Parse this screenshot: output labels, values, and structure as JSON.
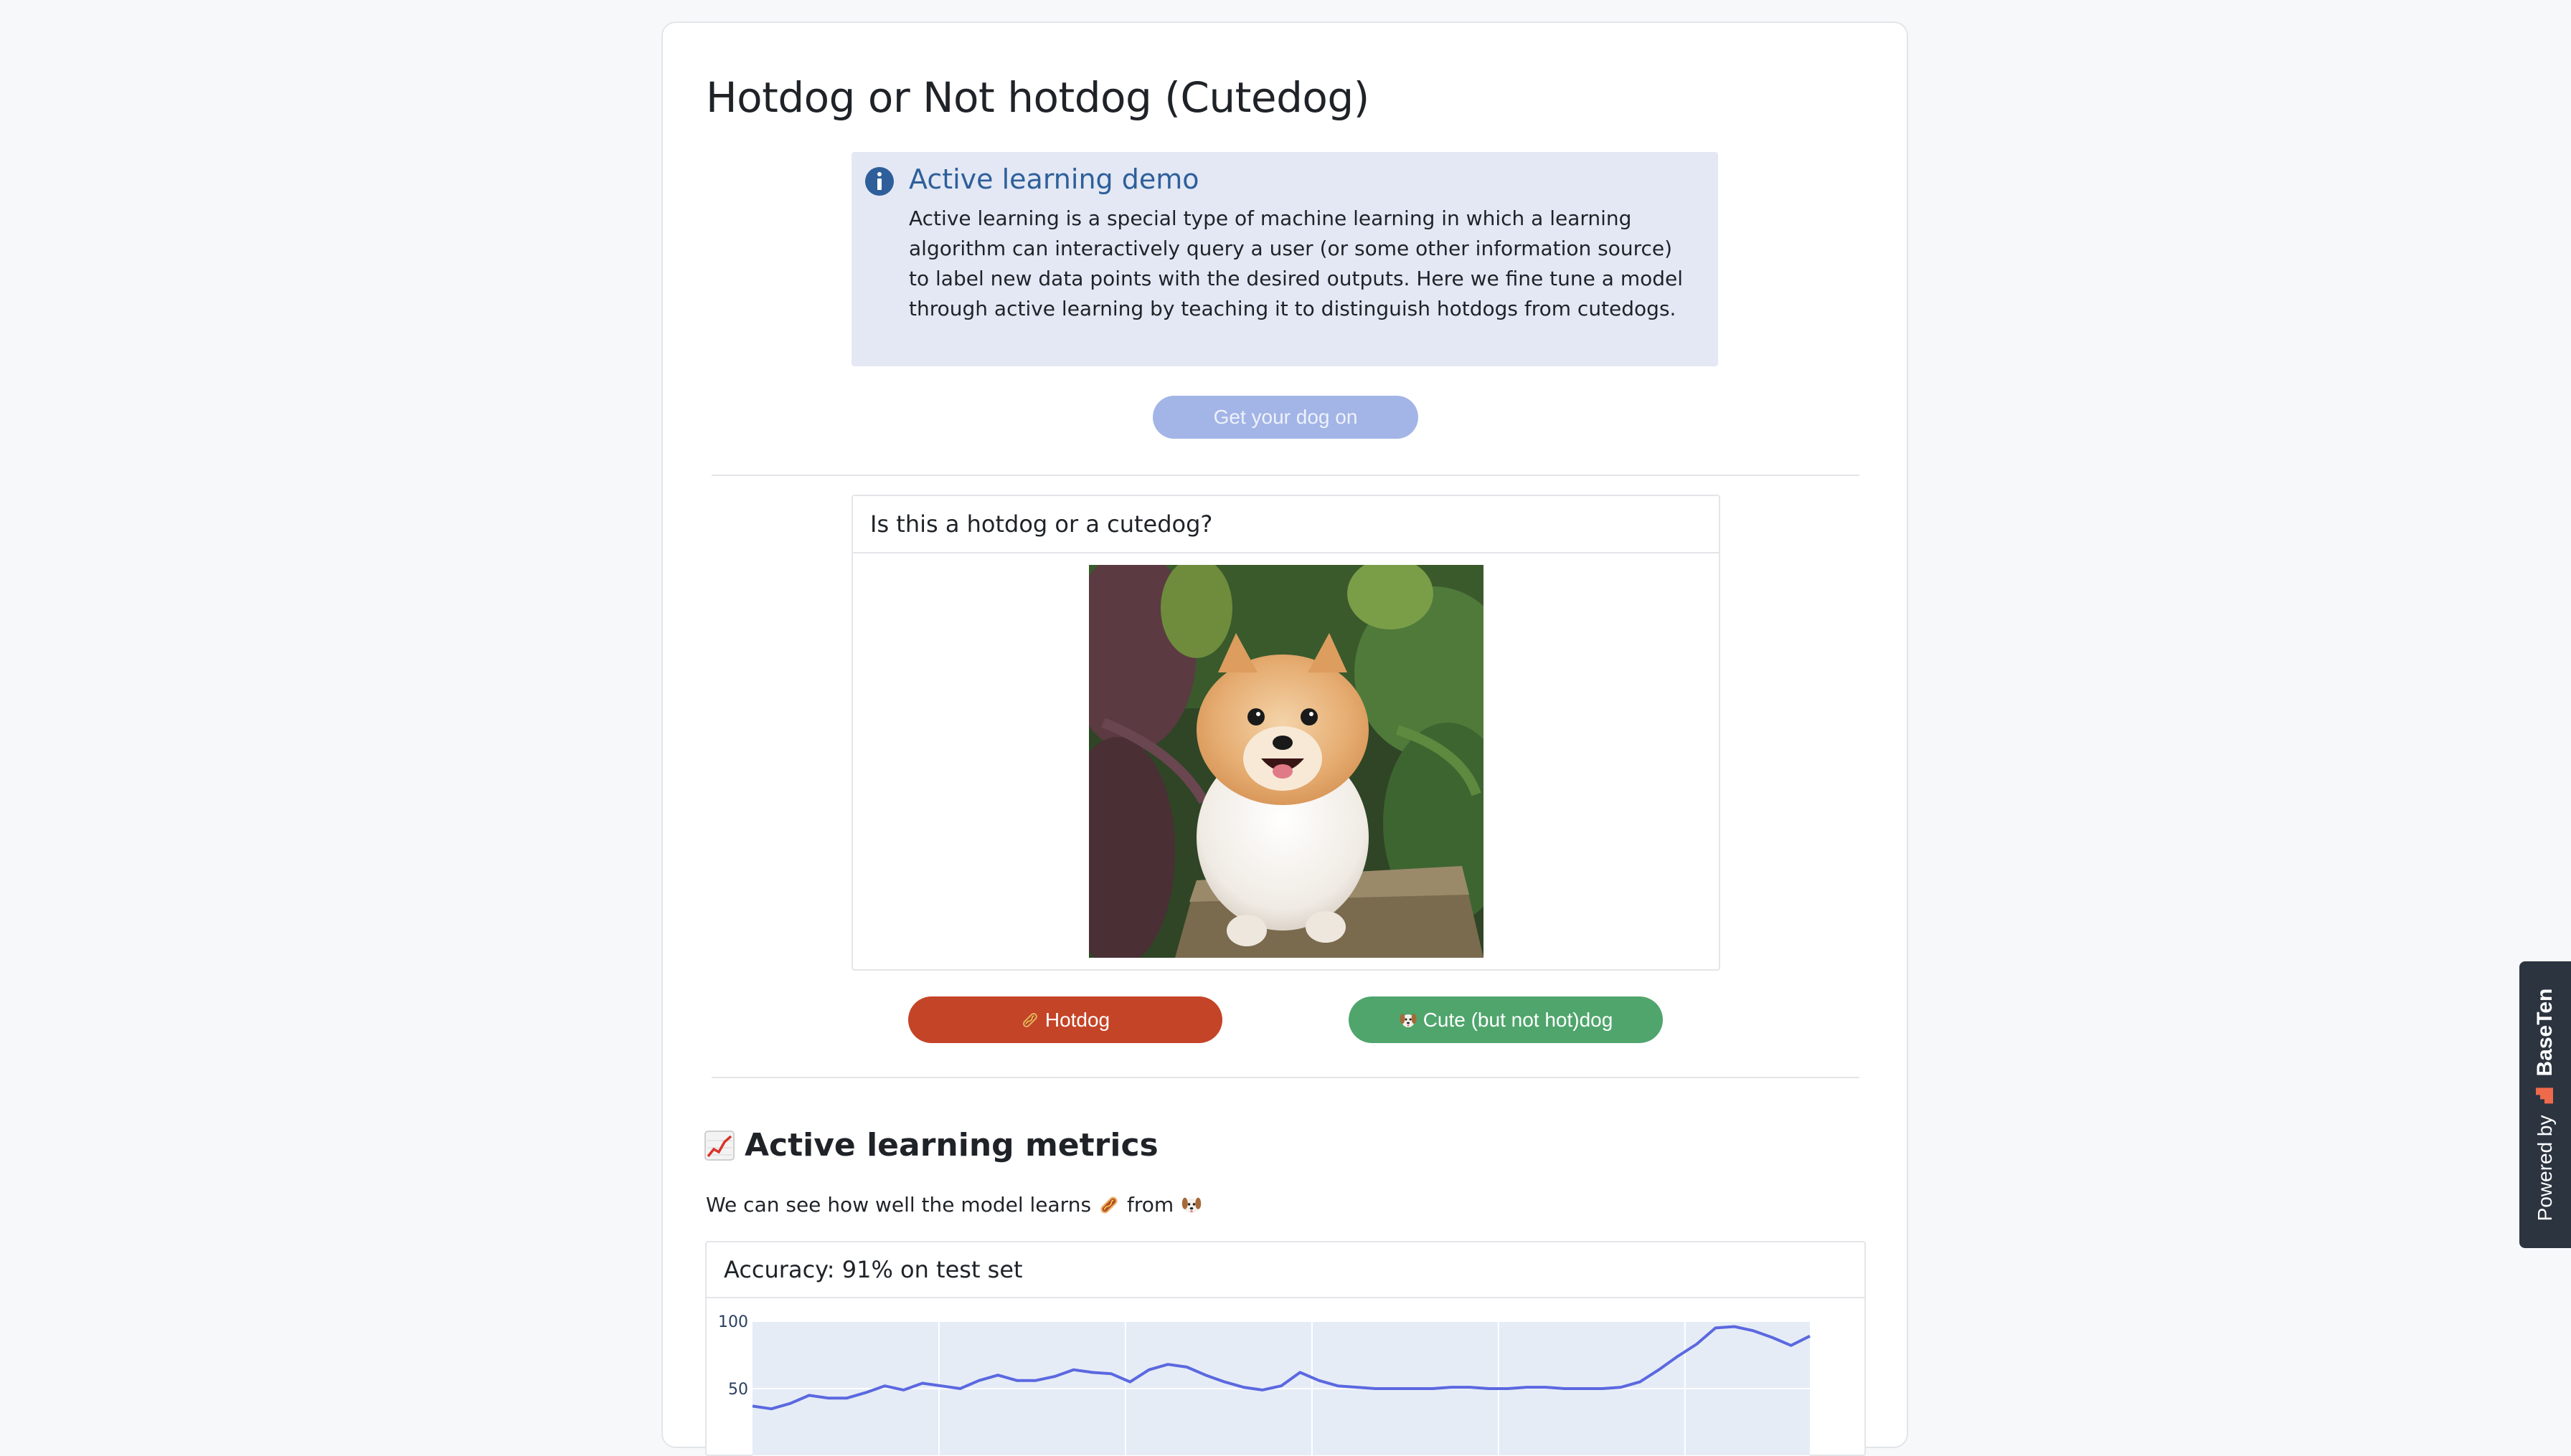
{
  "page": {
    "title": "Hotdog or Not hotdog (Cutedog)"
  },
  "info_box": {
    "heading": "Active learning demo",
    "body": "Active learning is a special type of machine learning in which a learning algorithm can interactively query a user (or some other information source) to label new data points with the desired outputs. Here we fine tune a model through active learning by teaching it to distinguish hotdogs from cutedogs.",
    "icon": "info-icon"
  },
  "start_button": {
    "label": "Get your dog on"
  },
  "question_panel": {
    "question": "Is this a hotdog or a cutedog?"
  },
  "label_buttons": {
    "hotdog": {
      "label": "Hotdog",
      "icon": "hotdog-icon"
    },
    "cute": {
      "label": "Cute (but not hot)dog",
      "icon": "dog-face-icon"
    }
  },
  "metrics": {
    "title": "Active learning metrics",
    "title_icon": "chart-increasing-icon",
    "subtitle_prefix": "We can see how well the model learns",
    "subtitle_mid": "from"
  },
  "accuracy_panel": {
    "header": "Accuracy: 91% on test set"
  },
  "chart_data": {
    "type": "line",
    "ylim": [
      0,
      100
    ],
    "y_ticks": [
      "100",
      "50"
    ],
    "series": [
      {
        "values": [
          37,
          35,
          39,
          45,
          43,
          43,
          47,
          52,
          49,
          54,
          52,
          50,
          56,
          60,
          56,
          56,
          59,
          64,
          62,
          61,
          55,
          64,
          68,
          66,
          60,
          55,
          51,
          49,
          52,
          62,
          56,
          52,
          51,
          50,
          50,
          50,
          50,
          51,
          51,
          50,
          50,
          51,
          51,
          50,
          50,
          50,
          51,
          55,
          64,
          74,
          83,
          95,
          96,
          93,
          88,
          82,
          89
        ]
      }
    ],
    "line_color": "#5b68e0",
    "plot_bg": "#e5ecf6",
    "grid": true
  },
  "powered_by": {
    "prefix": "Powered by",
    "brand": "BaseTen"
  },
  "colors": {
    "hotdog_button": "#c44427",
    "cute_button": "#4fa56c",
    "primary_disabled": "#a3b4e6",
    "info_bg": "#e3e8f4",
    "info_heading": "#2e5f9a"
  }
}
